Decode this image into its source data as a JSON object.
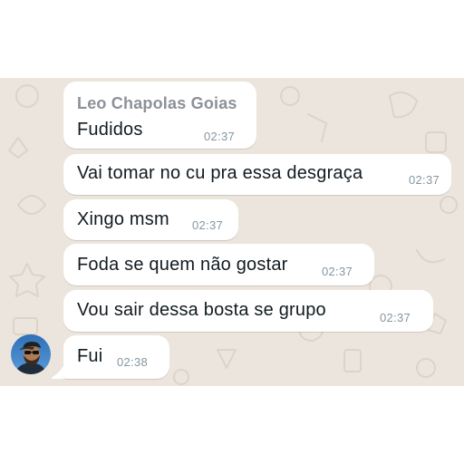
{
  "chat": {
    "sender_name": "Leo Chapolas Goias",
    "messages": [
      {
        "text": "Fudidos",
        "time": "02:37"
      },
      {
        "text": "Vai tomar no cu pra essa desgraça",
        "time": "02:37"
      },
      {
        "text": "Xingo msm",
        "time": "02:37"
      },
      {
        "text": "Foda se quem não gostar",
        "time": "02:37"
      },
      {
        "text": "Vou sair dessa bosta se grupo",
        "time": "02:37"
      },
      {
        "text": "Fui",
        "time": "02:38"
      }
    ]
  },
  "colors": {
    "chat_background": "#ece5dd",
    "bubble": "#ffffff",
    "sender_name": "#8b9298",
    "timestamp": "#8696a0",
    "message_text": "#111b21"
  },
  "icons": {
    "avatar": "sender-avatar-photo"
  }
}
